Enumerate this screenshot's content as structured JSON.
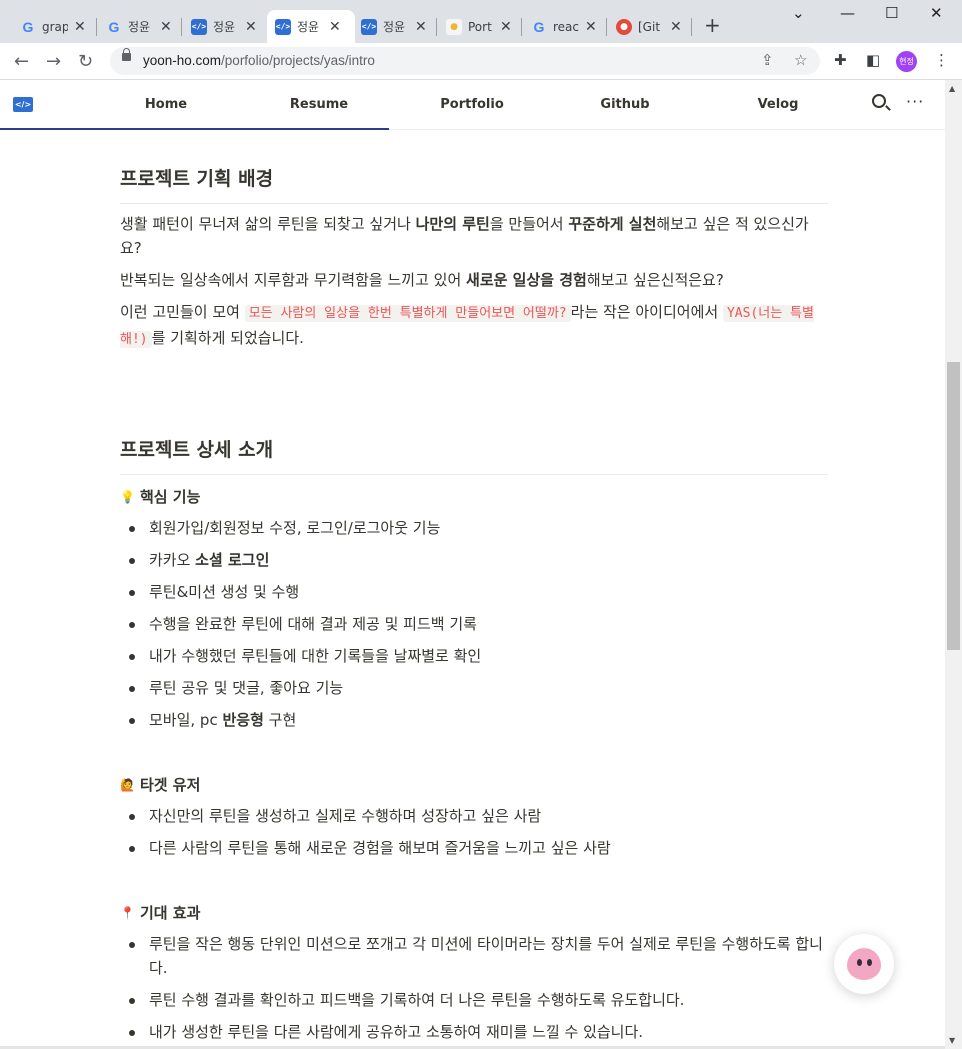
{
  "browser": {
    "tabs": [
      {
        "icon": "google-icon",
        "title": "graph"
      },
      {
        "icon": "google-icon",
        "title": "정윤"
      },
      {
        "icon": "code-icon",
        "title": "정윤"
      },
      {
        "icon": "code-icon",
        "title": "정윤",
        "active": true
      },
      {
        "icon": "code-icon",
        "title": "정윤"
      },
      {
        "icon": "bulb-icon",
        "title": "Port"
      },
      {
        "icon": "google-icon",
        "title": "reac"
      },
      {
        "icon": "github-red-icon",
        "title": "[Git"
      }
    ],
    "new_tab": "+",
    "url_domain": "yoon-ho.com",
    "url_path": "/porfolio/projects/yas/intro",
    "profile_initials": "현정"
  },
  "site": {
    "logo": "</>",
    "nav": [
      "Home",
      "Resume",
      "Portfolio",
      "Github",
      "Velog"
    ],
    "more": "···"
  },
  "content": {
    "section1": {
      "title": "프로젝트 기획 배경",
      "p1_a": "생활 패턴이 무너져 삶의 루틴을 되찾고 싶거나 ",
      "p1_b": "나만의 루틴",
      "p1_c": "을 만들어서 ",
      "p1_d": "꾸준하게 실천",
      "p1_e": "해보고 싶은 적 있으신가요?",
      "p2_a": "반복되는 일상속에서 지루함과 무기력함을 느끼고 있어 ",
      "p2_b": "새로운 일상을 경험",
      "p2_c": "해보고 싶은신적은요?",
      "p3_a": "이런 고민들이 모여 ",
      "p3_code1": "모든 사람의 일상을 한번 특별하게 만들어보면 어떨까?",
      "p3_b": "라는 작은 아이디어에서 ",
      "p3_code2": "YAS(너는 특별해!)",
      "p3_c": "를 기획하게 되었습니다."
    },
    "section2": {
      "title": "프로젝트 상세 소개",
      "core": {
        "emoji": "💡",
        "title": "핵심 기능",
        "items": [
          {
            "a": "회원가입/회원정보 수정, 로그인/로그아웃 기능",
            "b": "",
            "c": ""
          },
          {
            "a": "카카오 ",
            "b": "소셜 로그인",
            "c": ""
          },
          {
            "a": "루틴&미션 생성 및 수행",
            "b": "",
            "c": ""
          },
          {
            "a": "수행을 완료한 루틴에 대해 결과 제공 및 피드백 기록",
            "b": "",
            "c": ""
          },
          {
            "a": "내가 수행했던 루틴들에 대한 기록들을 날짜별로 확인",
            "b": "",
            "c": ""
          },
          {
            "a": "루틴 공유 및 댓글, 좋아요 기능",
            "b": "",
            "c": ""
          },
          {
            "a": "모바일, pc ",
            "b": "반응형",
            "c": " 구현"
          }
        ]
      },
      "target": {
        "emoji": "🙋",
        "title": "타겟 유저",
        "items": [
          "자신만의 루틴을 생성하고 실제로 수행하며 성장하고 싶은 사람",
          "다른 사람의 루틴을 통해 새로운 경험을 해보며 즐거움을 느끼고 싶은 사람"
        ]
      },
      "effect": {
        "emoji": "📍",
        "title": "기대 효과",
        "items": [
          "루틴을 작은 행동 단위인 미션으로 쪼개고 각 미션에 타이머라는 장치를 두어 실제로 루틴을 수행하도록 합니다.",
          "루틴 수행 결과를 확인하고 피드백을 기록하여 더 나은 루틴을 수행하도록 유도합니다.",
          "내가 생성한 루틴을 다른 사람에게 공유하고 소통하여 재미를 느낄 수 있습니다."
        ]
      }
    }
  }
}
